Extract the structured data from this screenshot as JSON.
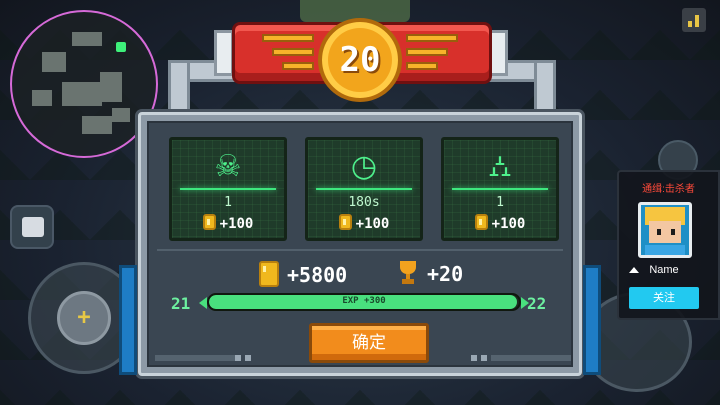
{
  "banner": {
    "level": "20"
  },
  "kills_panel": {
    "title": "通缉:击杀者",
    "name": "Name",
    "follow_label": "关注"
  },
  "stats": [
    {
      "icon": "skull-icon",
      "value": "1",
      "reward": "+100"
    },
    {
      "icon": "clock-icon",
      "value": "180s",
      "reward": "+100"
    },
    {
      "icon": "tombstone-icon",
      "value": "1",
      "reward": "+100"
    }
  ],
  "totals": {
    "coins": "+5800",
    "trophies": "+20"
  },
  "experience": {
    "current_level": "21",
    "next_level": "22",
    "gain_label": "EXP +300",
    "progress": 0.995
  },
  "buttons": {
    "confirm_label": "确定"
  },
  "colors": {
    "accent_green": "#49e07e",
    "banner_red": "#d8302b",
    "coin_gold": "#f0b81e",
    "confirm_orange": "#f28c1c",
    "follow_cyan": "#22c9f0",
    "kill_title_red": "#ff4a3a"
  }
}
